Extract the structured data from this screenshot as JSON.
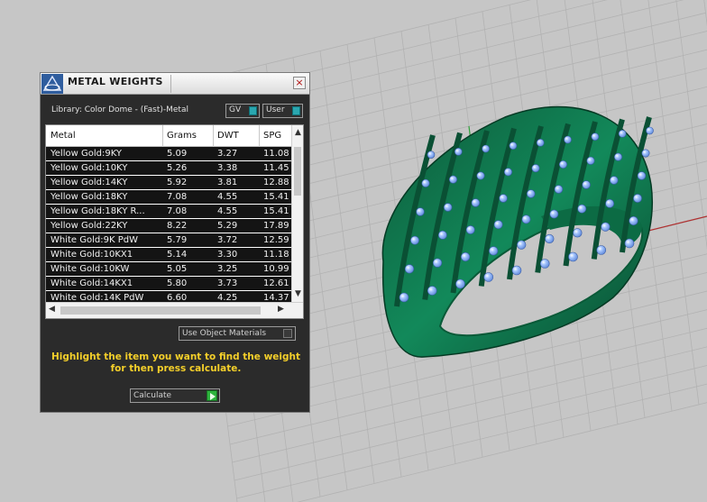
{
  "panel": {
    "title": "METAL WEIGHTS",
    "close_glyph": "×",
    "library": "Library: Color Dome - (Fast)-Metal",
    "toggles": {
      "gv": "GV",
      "user": "User"
    },
    "table": {
      "columns": [
        "Metal",
        "Grams",
        "DWT",
        "SPG"
      ],
      "rows": [
        {
          "metal": "Yellow Gold:9KY",
          "grams": "5.09",
          "dwt": "3.27",
          "spg": "11.08"
        },
        {
          "metal": "Yellow Gold:10KY",
          "grams": "5.26",
          "dwt": "3.38",
          "spg": "11.45"
        },
        {
          "metal": "Yellow Gold:14KY",
          "grams": "5.92",
          "dwt": "3.81",
          "spg": "12.88"
        },
        {
          "metal": "Yellow Gold:18KY",
          "grams": "7.08",
          "dwt": "4.55",
          "spg": "15.41"
        },
        {
          "metal": "Yellow Gold:18KY R...",
          "grams": "7.08",
          "dwt": "4.55",
          "spg": "15.41"
        },
        {
          "metal": "Yellow Gold:22KY",
          "grams": "8.22",
          "dwt": "5.29",
          "spg": "17.89"
        },
        {
          "metal": "White Gold:9K PdW",
          "grams": "5.79",
          "dwt": "3.72",
          "spg": "12.59"
        },
        {
          "metal": "White Gold:10KX1",
          "grams": "5.14",
          "dwt": "3.30",
          "spg": "11.18"
        },
        {
          "metal": "White Gold:10KW",
          "grams": "5.05",
          "dwt": "3.25",
          "spg": "10.99"
        },
        {
          "metal": "White Gold:14KX1",
          "grams": "5.80",
          "dwt": "3.73",
          "spg": "12.61"
        },
        {
          "metal": "White Gold:14K PdW",
          "grams": "6.60",
          "dwt": "4.25",
          "spg": "14.37"
        }
      ]
    },
    "use_object_materials": "Use Object Materials",
    "instructions_line1": "Highlight the item you want to find the weight",
    "instructions_line2": "for then press calculate.",
    "calculate": "Calculate"
  },
  "colors": {
    "panel_bg": "#2b2b2b",
    "instruction_text": "#f4cf2a",
    "row_bg": "#141414",
    "ring_metal": "#0f7a4f",
    "gem": "#8fb6ff",
    "grid_line": "#b2b2b2",
    "axis_x": "#b03030",
    "axis_y": "#2fa23a"
  },
  "icons": [
    "app-logo-icon",
    "close-icon",
    "scroll-up-icon",
    "scroll-down-icon",
    "scroll-left-icon",
    "scroll-right-icon",
    "play-icon"
  ]
}
